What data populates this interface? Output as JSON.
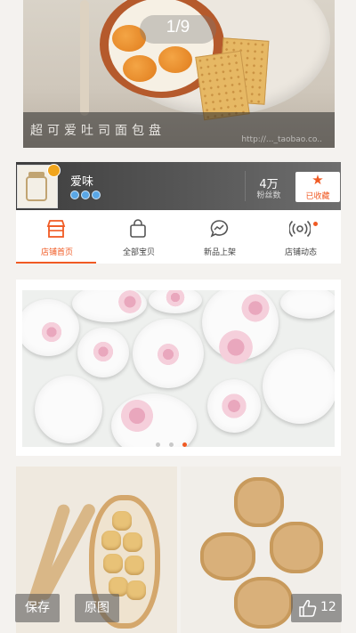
{
  "viewer": {
    "counter": "1/9",
    "caption": "超可爱吐司面包盘",
    "watermark": "http://..._taobao.co.."
  },
  "shop": {
    "name": "爱味",
    "fans_count": "4万",
    "fans_label": "粉丝数",
    "favorite_label": "已收藏"
  },
  "tabs": [
    {
      "label": "店铺首页",
      "icon": "shop-icon",
      "active": true
    },
    {
      "label": "全部宝贝",
      "icon": "bag-icon",
      "active": false
    },
    {
      "label": "新品上架",
      "icon": "chat-bubble-icon",
      "active": false
    },
    {
      "label": "店铺动态",
      "icon": "broadcast-icon",
      "active": false
    }
  ],
  "banner": {
    "slides": 3,
    "active_slide": 3
  },
  "actions": {
    "save_label": "保存",
    "original_label": "原图",
    "like_count": "12"
  },
  "colors": {
    "accent": "#f05a23",
    "header_bg": "#4a4a4a"
  }
}
